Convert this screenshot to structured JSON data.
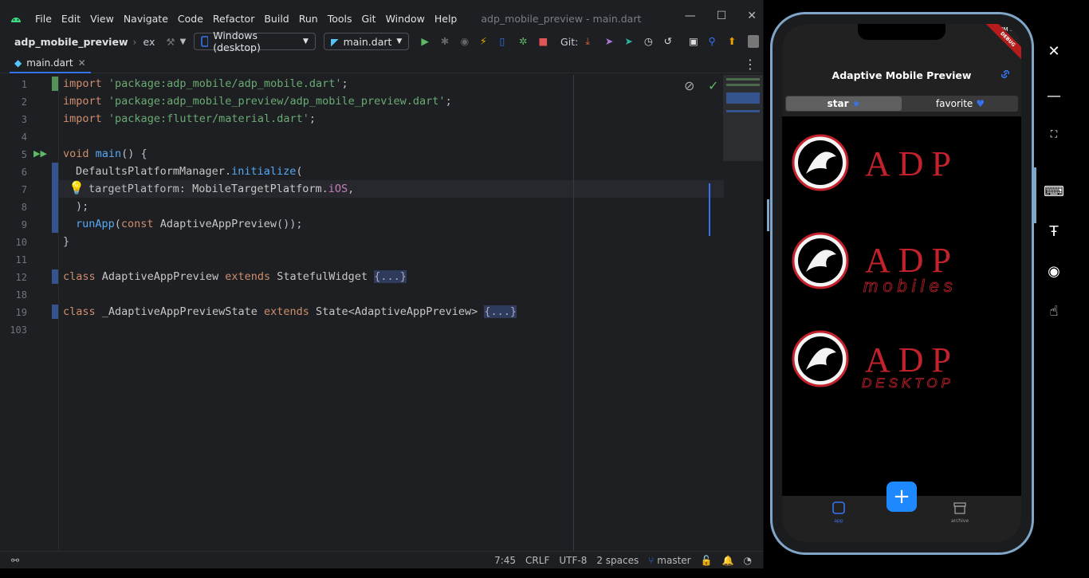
{
  "menu": {
    "items": [
      "File",
      "Edit",
      "View",
      "Navigate",
      "Code",
      "Refactor",
      "Build",
      "Run",
      "Tools",
      "Git",
      "Window",
      "Help"
    ],
    "window_title": "adp_mobile_preview - main.dart"
  },
  "toolbar": {
    "project": "adp_mobile_preview",
    "crumb": "ex",
    "device": "Windows (desktop)",
    "run_config": "main.dart",
    "git_label": "Git:"
  },
  "tab": {
    "label": "main.dart"
  },
  "editor": {
    "line_numbers": [
      "1",
      "2",
      "3",
      "4",
      "5",
      "6",
      "7",
      "8",
      "9",
      "10",
      "11",
      "12",
      "18",
      "19",
      "103"
    ],
    "lines": {
      "l1": "'package:adp_mobile/adp_mobile.dart'",
      "l2": "'package:adp_mobile_preview/adp_mobile_preview.dart'",
      "l3": "'package:flutter/material.dart'",
      "kw_import": "import",
      "kw_void": "void",
      "fn_main": "main",
      "l6_cls": "DefaultsPlatformManager",
      "l6_fn": "initialize",
      "l7_param": "targetPlatform",
      "l7_cls": "MobileTargetPlatform",
      "l7_val": "iOS",
      "l9_fn": "runApp",
      "kw_const": "const",
      "l9_cls": "AdaptiveAppPreview",
      "kw_class": "class",
      "kw_extends": "extends",
      "l12_cls": "AdaptiveAppPreview",
      "l12_base": "StatefulWidget",
      "l19_cls": "_AdaptiveAppPreviewState",
      "l19_base": "State",
      "l19_gen": "AdaptiveAppPreview",
      "fold": "{...}"
    }
  },
  "status": {
    "position": "7:45",
    "line_sep": "CRLF",
    "encoding": "UTF-8",
    "indent": "2 spaces",
    "branch": "master"
  },
  "phone": {
    "time": "PM .",
    "banner": "DEBUG",
    "app_title": "Adaptive Mobile Preview",
    "segments": [
      "star",
      "favorite"
    ],
    "logos": [
      {
        "text": "ADP",
        "sub": ""
      },
      {
        "text": "ADP",
        "sub": "mobiles"
      },
      {
        "text": "ADP",
        "sub": "DESKTOP"
      }
    ],
    "nav": [
      "app",
      "archive"
    ],
    "fab": "+"
  },
  "colors": {
    "accent": "#3574f0",
    "fab": "#1e88ff",
    "logo_red": "#c3222c",
    "phone_frame": "#7fa6c8"
  }
}
